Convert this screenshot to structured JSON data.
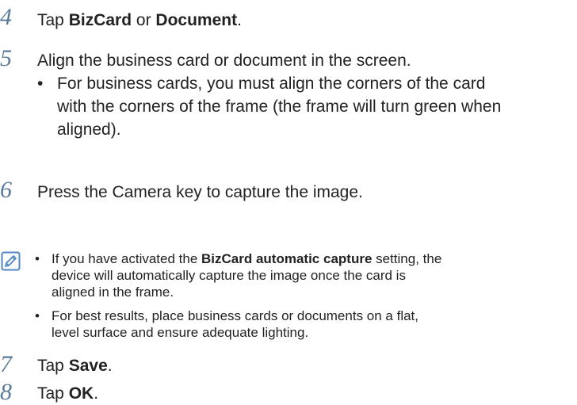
{
  "steps": [
    {
      "num": "4",
      "pre": "Tap ",
      "b1": "BizCard",
      "mid": " or ",
      "b2": "Document",
      "post": "."
    },
    {
      "num": "5",
      "text": "Align the business card or document in the screen."
    },
    {
      "num": "6",
      "text": "Press the Camera key to capture the image."
    },
    {
      "num": "7",
      "pre": "Tap ",
      "b1": "Save",
      "post": "."
    },
    {
      "num": "8",
      "pre": "Tap ",
      "b1": "OK",
      "post": "."
    }
  ],
  "step5_bullet": {
    "line1": "For business cards, you must align the corners of the card",
    "line2": "with the corners of the frame (the frame will turn green when",
    "line3": "aligned)."
  },
  "note": {
    "icon": "note-pencil-icon",
    "bullet1": {
      "pre": "If you have activated the ",
      "bold": "BizCard automatic capture",
      "post": " setting, the",
      "line2": "device will automatically capture the image once the card is",
      "line3": "aligned in the frame."
    },
    "bullet2": {
      "line1": "For best results, place business cards or documents on a flat,",
      "line2": "level surface and ensure adequate lighting."
    }
  },
  "bullet_char": "•",
  "colors": {
    "step_number": "#5a7a99",
    "text": "#222222",
    "note_icon": "#4f86c4"
  }
}
